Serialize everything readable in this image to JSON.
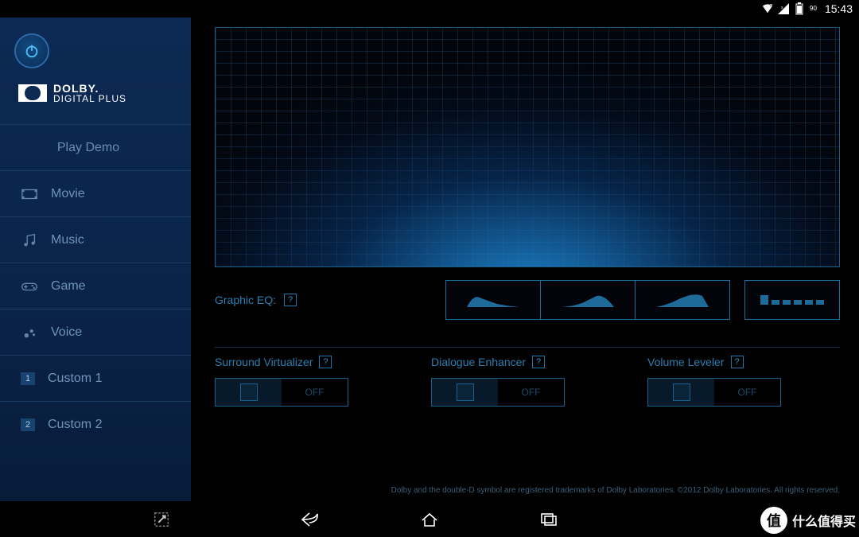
{
  "statusbar": {
    "time": "15:43",
    "signal_badge": "90"
  },
  "brand": {
    "line1": "DOLBY.",
    "line2": "DIGITAL PLUS"
  },
  "sidebar": {
    "play_demo": "Play Demo",
    "items": [
      {
        "label": "Movie"
      },
      {
        "label": "Music"
      },
      {
        "label": "Game"
      },
      {
        "label": "Voice"
      },
      {
        "label": "Custom 1",
        "badge": "1"
      },
      {
        "label": "Custom 2",
        "badge": "2"
      }
    ]
  },
  "eq": {
    "label": "Graphic EQ:",
    "help": "?",
    "presets": [
      "curve-a",
      "curve-b",
      "curve-c",
      "custom-blocks"
    ]
  },
  "toggles": [
    {
      "label": "Surround Virtualizer",
      "help": "?",
      "state": "off",
      "off_text": "OFF"
    },
    {
      "label": "Dialogue Enhancer",
      "help": "?",
      "state": "off",
      "off_text": "OFF"
    },
    {
      "label": "Volume Leveler",
      "help": "?",
      "state": "off",
      "off_text": "OFF"
    }
  ],
  "footer": "Dolby and the double-D symbol are registered trademarks of Dolby Laboratories. ©2012 Dolby Laboratories. All rights reserved.",
  "watermark": {
    "badge": "值",
    "text": "什么值得买"
  }
}
